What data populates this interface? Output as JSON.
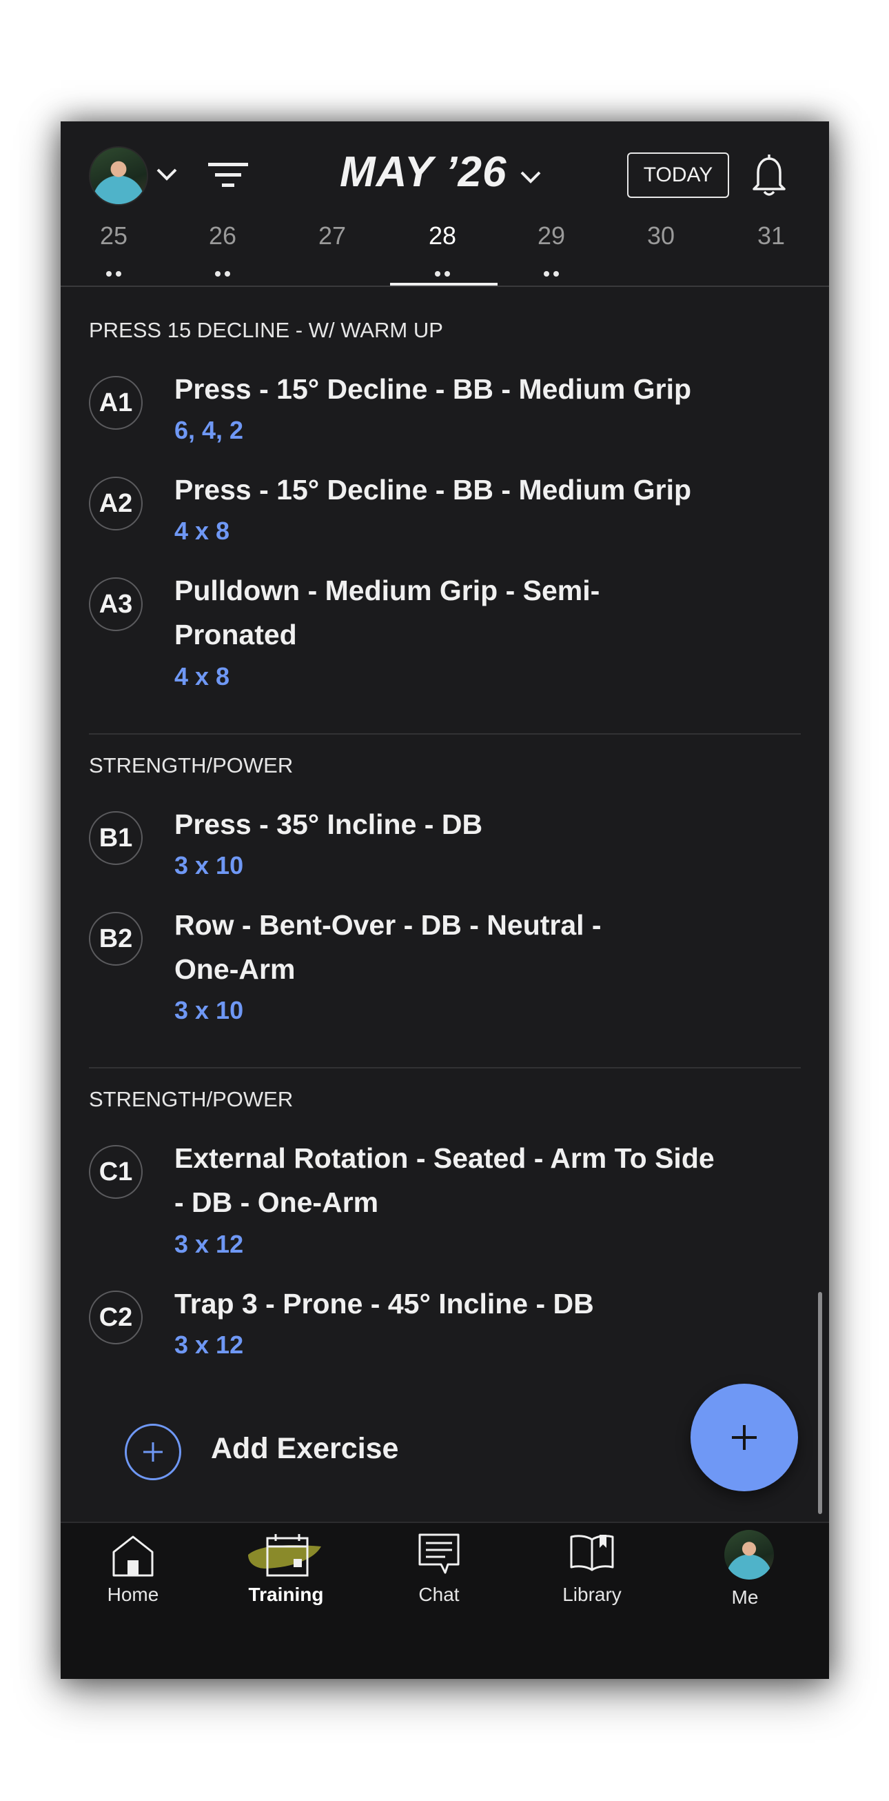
{
  "header": {
    "month": "MAY ’26",
    "today_label": "TODAY",
    "days": [
      "25",
      "26",
      "27",
      "28",
      "29",
      "30",
      "31"
    ],
    "selected_day": "28"
  },
  "sections": [
    {
      "title": "PRESS 15 DECLINE - W/ WARM UP",
      "exercises": [
        {
          "code": "A1",
          "name": "Press - 15° Decline - BB - Medium Grip",
          "sets": "6, 4, 2"
        },
        {
          "code": "A2",
          "name": "Press - 15° Decline - BB - Medium Grip",
          "sets": "4 x 8"
        },
        {
          "code": "A3",
          "name": "Pulldown - Medium Grip - Semi-Pronated",
          "sets": "4 x 8"
        }
      ]
    },
    {
      "title": "STRENGTH/POWER",
      "exercises": [
        {
          "code": "B1",
          "name": "Press - 35° Incline - DB",
          "sets": "3 x 10"
        },
        {
          "code": "B2",
          "name": "Row - Bent-Over - DB - Neutral - One-Arm",
          "sets": "3 x 10"
        }
      ]
    },
    {
      "title": "STRENGTH/POWER",
      "exercises": [
        {
          "code": "C1",
          "name": "External Rotation - Seated - Arm To Side - DB - One-Arm",
          "sets": "3 x 12"
        },
        {
          "code": "C2",
          "name": "Trap 3 - Prone - 45° Incline - DB",
          "sets": "3 x 12"
        }
      ]
    }
  ],
  "add_exercise_label": "Add Exercise",
  "nav": [
    {
      "label": "Home",
      "icon": "home-icon"
    },
    {
      "label": "Training",
      "icon": "calendar-icon",
      "active": true
    },
    {
      "label": "Chat",
      "icon": "chat-icon"
    },
    {
      "label": "Library",
      "icon": "book-icon"
    },
    {
      "label": "Me",
      "icon": "avatar"
    }
  ],
  "colors": {
    "accent": "#6f98f5",
    "background": "#1b1b1d",
    "highlight": "#8a8a2a"
  }
}
